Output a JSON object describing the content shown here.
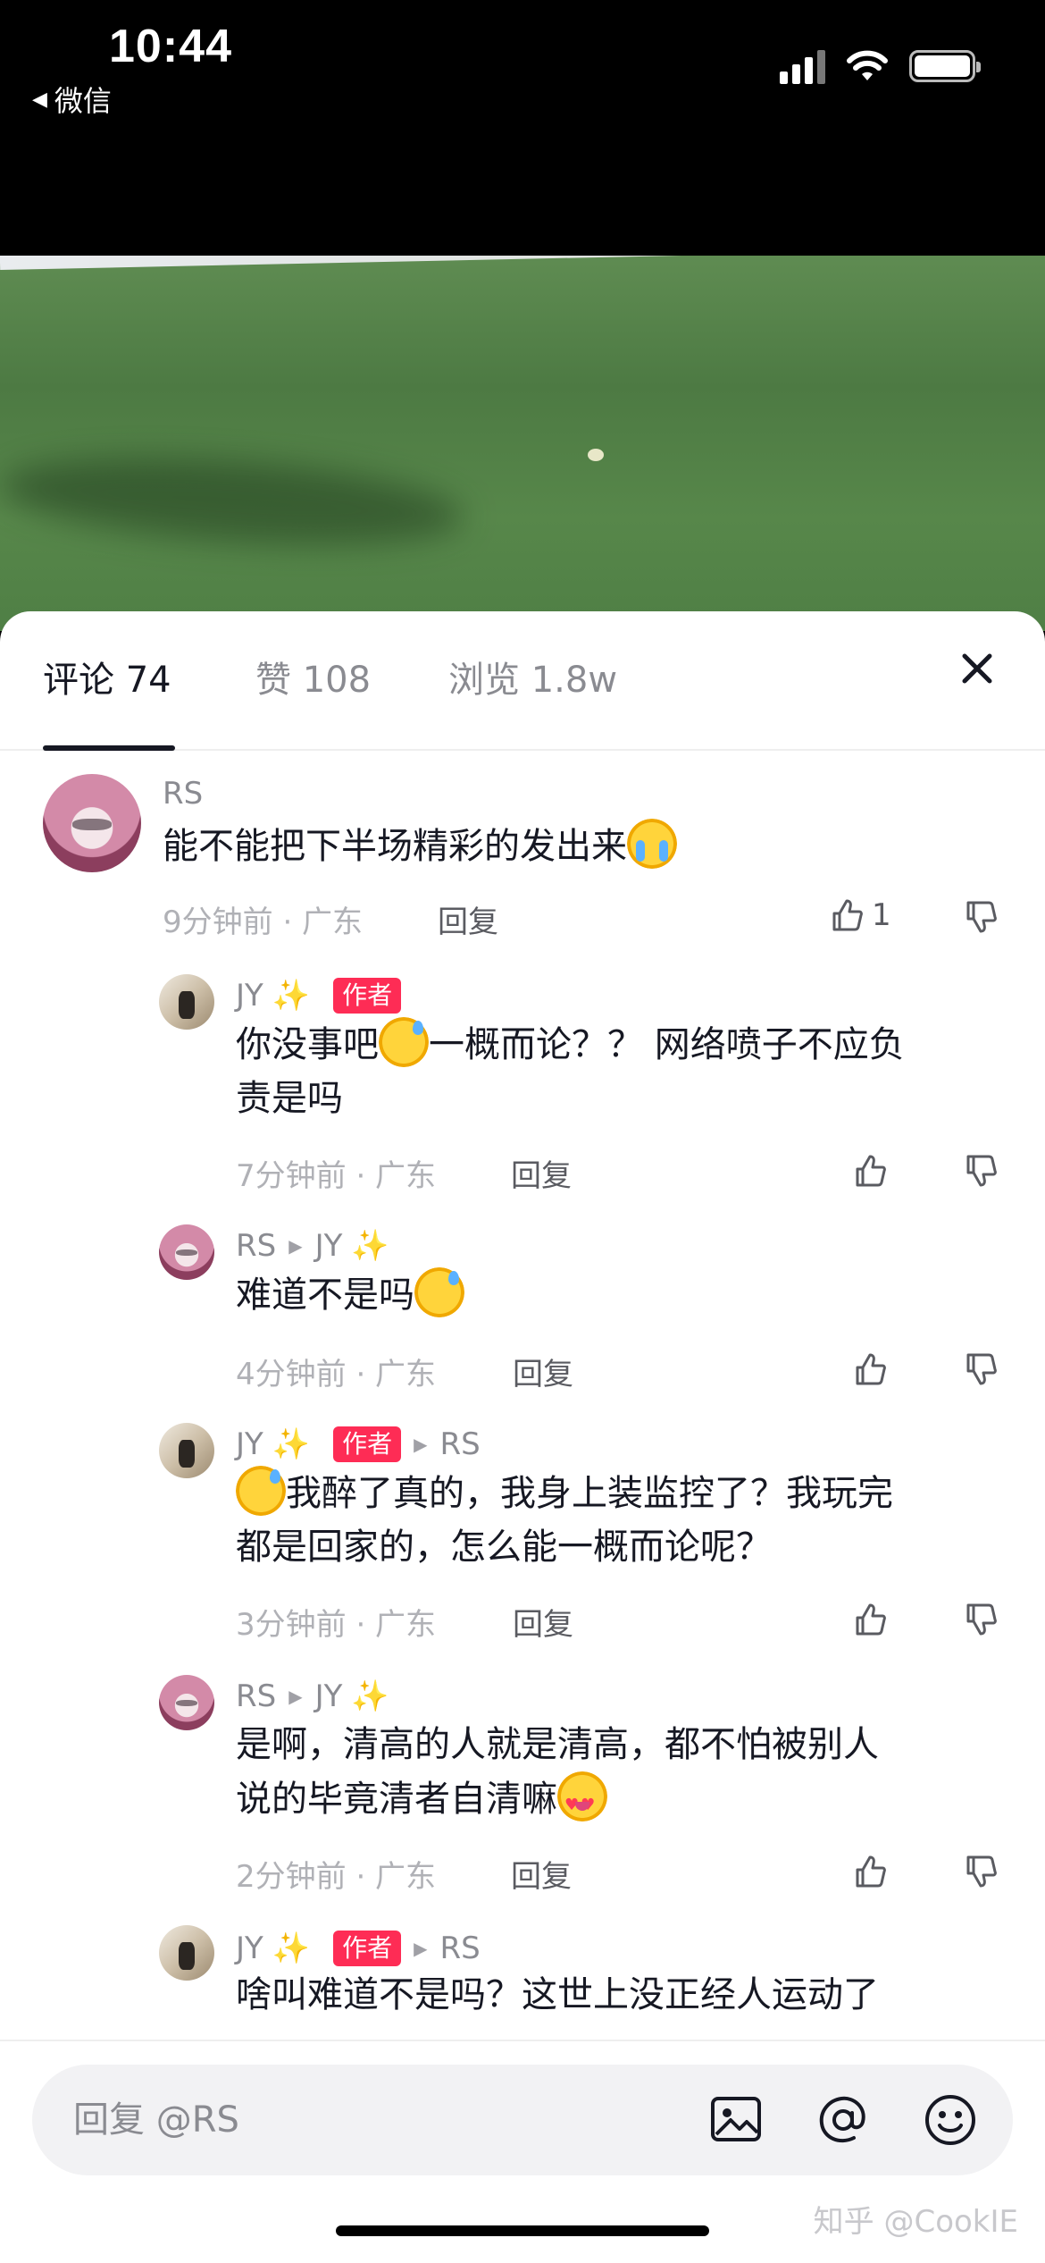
{
  "status_bar": {
    "time": "10:44",
    "back_app": "微信"
  },
  "tabs": [
    {
      "label": "评论 74"
    },
    {
      "label": "赞 108"
    },
    {
      "label": "浏览 1.8w"
    }
  ],
  "author_badge": "作者",
  "reply_label": "回复",
  "comments": [
    {
      "user": "RS",
      "text": "能不能把下半场精彩的发出来",
      "time": "9分钟前 · 广东",
      "likes": "1"
    },
    {
      "user": "JY",
      "text_a": "你没事吧",
      "text_b": "一概而论？？ 网络喷子不应负",
      "text_c": "责是吗",
      "time": "7分钟前 · 广东"
    },
    {
      "user": "RS",
      "to": "JY",
      "text": "难道不是吗",
      "time": "4分钟前 · 广东"
    },
    {
      "user": "JY",
      "to": "RS",
      "text_a": "我醉了真的，我身上装监控了？我玩完",
      "text_b": "都是回家的，怎么能一概而论呢？",
      "time": "3分钟前 · 广东"
    },
    {
      "user": "RS",
      "to": "JY",
      "text_a": "是啊，清高的人就是清高，都不怕被别人",
      "text_b": "说的毕竟清者自清嘛",
      "time": "2分钟前 · 广东"
    },
    {
      "user": "JY",
      "to": "RS",
      "text": "啥叫难道不是吗？这世上没正经人运动了"
    }
  ],
  "input": {
    "placeholder": "回复 @RS"
  },
  "watermark": "知乎 @CookIE",
  "icons": [
    "close-icon",
    "thumb-up-icon",
    "thumb-down-icon",
    "image-icon",
    "at-icon",
    "emoji-icon",
    "sparkle-icon"
  ],
  "colors": {
    "author_badge": "#fe2c55",
    "text_primary": "#161823",
    "text_secondary": "#8a8b91"
  }
}
